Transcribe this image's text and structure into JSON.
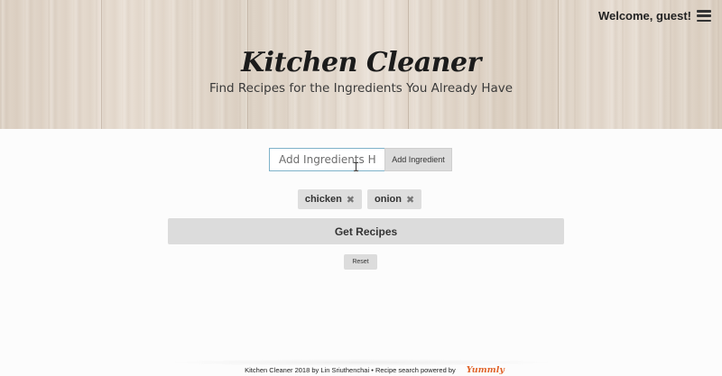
{
  "header": {
    "welcome_text": "Welcome, guest!",
    "menu_icon": "hamburger-menu-icon",
    "title": "Kitchen Cleaner",
    "subtitle": "Find Recipes for the Ingredients You Already Have"
  },
  "ingredient_form": {
    "input_placeholder": "Add Ingredients Here...",
    "input_value": "",
    "add_button_label": "Add Ingredient"
  },
  "ingredients": [
    {
      "label": "chicken",
      "remove_icon": "✖"
    },
    {
      "label": "onion",
      "remove_icon": "✖"
    }
  ],
  "actions": {
    "get_recipes_label": "Get Recipes",
    "reset_label": "Reset"
  },
  "footer": {
    "text": "Kitchen Cleaner 2018 by Lin Sriuthenchai • Recipe search powered by",
    "logo_text": "Yummly"
  },
  "colors": {
    "accent_logo": "#e0642a",
    "button_bg": "#dcdcdc",
    "input_border": "#7fb2c9"
  }
}
